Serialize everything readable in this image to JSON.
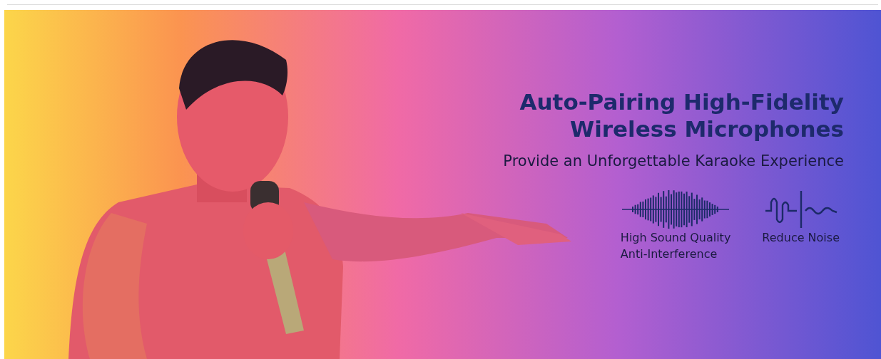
{
  "banner": {
    "kind": "picture",
    "headline": [
      "Auto-Pairing High-Fidelity",
      "Wireless Microphones"
    ],
    "subtitle": "Provide an Unforgettable Karaoke Experience",
    "features": [
      {
        "kind": "waveform",
        "label": "High Sound Quality\nAnti-Interference"
      },
      {
        "kind": "noise",
        "label": "Reduce Noise"
      }
    ]
  }
}
